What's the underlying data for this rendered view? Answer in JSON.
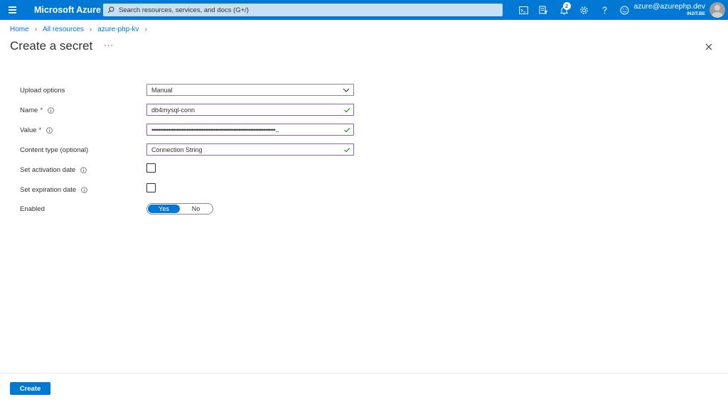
{
  "header": {
    "brand": "Microsoft Azure",
    "search_placeholder": "Search resources, services, and docs (G+/)",
    "notifications_count": "2",
    "account_email": "azure@azurephp.dev",
    "account_org": "IN2IT.BE",
    "icons": [
      "cloud-shell-icon",
      "directory-filter-icon",
      "notifications-icon",
      "settings-icon",
      "help-icon",
      "feedback-icon"
    ]
  },
  "breadcrumb": {
    "items": [
      "Home",
      "All resources",
      "azure-php-kv"
    ]
  },
  "page": {
    "title": "Create a secret",
    "more_label": "···"
  },
  "form": {
    "upload_options": {
      "label": "Upload options",
      "value": "Manual"
    },
    "name": {
      "label": "Name",
      "required": "*",
      "value": "db4mysql-conn"
    },
    "value": {
      "label": "Value",
      "required": "*",
      "value": "••••••••••••••••••••••••••••••••••••••••••••••••••••••••••••••••••••••••••..."
    },
    "content_type": {
      "label": "Content type (optional)",
      "value": "Connection String"
    },
    "activation_date": {
      "label": "Set activation date"
    },
    "expiration_date": {
      "label": "Set expiration date"
    },
    "enabled": {
      "label": "Enabled",
      "yes": "Yes",
      "no": "No",
      "selected": "Yes"
    }
  },
  "footer": {
    "create_label": "Create"
  },
  "colors": {
    "accent": "#0078d4",
    "valid_border": "#8764b8",
    "valid_check": "#107c10",
    "required": "#a4262c"
  }
}
